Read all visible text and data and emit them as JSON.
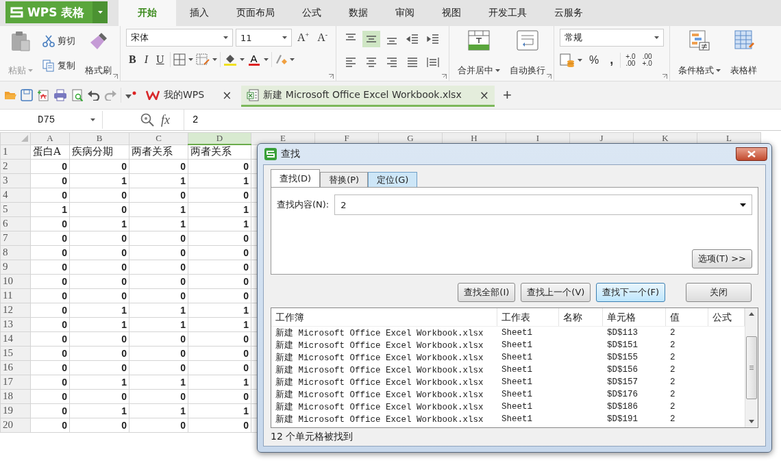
{
  "app_button": {
    "label": "WPS 表格"
  },
  "ribbon_tabs": [
    {
      "label": "开始",
      "selected": true
    },
    {
      "label": "插入",
      "selected": false
    },
    {
      "label": "页面布局",
      "selected": false
    },
    {
      "label": "公式",
      "selected": false
    },
    {
      "label": "数据",
      "selected": false
    },
    {
      "label": "审阅",
      "selected": false
    },
    {
      "label": "视图",
      "selected": false
    },
    {
      "label": "开发工具",
      "selected": false
    },
    {
      "label": "云服务",
      "selected": false
    }
  ],
  "clipboard": {
    "paste": "粘贴",
    "cut": "剪切",
    "copy": "复制",
    "format_painter": "格式刷"
  },
  "font": {
    "name": "宋体",
    "size": "11",
    "grow": "A$^{+}$",
    "shrink": "A$^{-}$",
    "bold": "B",
    "italic": "I",
    "underline": "U",
    "font_color": "A"
  },
  "alignment": [
    {
      "kind": "top",
      "selected": false
    },
    {
      "kind": "middle",
      "selected": true
    },
    {
      "kind": "bottom",
      "selected": false
    },
    {
      "kind": "outdent",
      "selected": false
    },
    {
      "kind": "indent",
      "selected": false
    },
    {
      "kind": "left",
      "selected": false
    },
    {
      "kind": "center",
      "selected": false
    },
    {
      "kind": "right",
      "selected": false
    },
    {
      "kind": "justify",
      "selected": false
    },
    {
      "kind": "distributed",
      "selected": false
    }
  ],
  "merge_center": "合并居中",
  "wrap_text": "自动换行",
  "number": {
    "format": "常规",
    "percent": "%",
    "comma": ",",
    "increase_decimal": [
      "+.0",
      ".00"
    ],
    "decrease_decimal": [
      ".00",
      "+.0"
    ]
  },
  "styles": {
    "conditional_format": "条件格式",
    "table_style": "表格样"
  },
  "doc_tabs": [
    {
      "kind": "home",
      "label": "我的WPS",
      "close": "×",
      "selected": false
    },
    {
      "kind": "workbook",
      "label": "新建 Microsoft Office Excel Workbook.xlsx",
      "close": "×",
      "selected": true
    }
  ],
  "new_tab": "+",
  "formula_bar": {
    "cell": "D75",
    "fx": "fx",
    "value": "2"
  },
  "sheet": {
    "columns": [
      {
        "label": "A",
        "selected": false
      },
      {
        "label": "B",
        "selected": false
      },
      {
        "label": "C",
        "selected": false
      },
      {
        "label": "D",
        "selected": true
      },
      {
        "label": "E",
        "selected": false
      },
      {
        "label": "F",
        "selected": false
      },
      {
        "label": "G",
        "selected": false
      },
      {
        "label": "H",
        "selected": false
      },
      {
        "label": "I",
        "selected": false
      },
      {
        "label": "J",
        "selected": false
      },
      {
        "label": "K",
        "selected": false
      },
      {
        "label": "L",
        "selected": false
      }
    ],
    "rows": [
      {
        "number": "1",
        "cells": [
          "蛋白A",
          "疾病分期",
          "两者关系",
          "两者关系"
        ]
      },
      {
        "number": "2",
        "cells": [
          "0",
          "0",
          "0",
          "0"
        ]
      },
      {
        "number": "3",
        "cells": [
          "0",
          "1",
          "1",
          "1"
        ]
      },
      {
        "number": "4",
        "cells": [
          "0",
          "0",
          "0",
          "0"
        ]
      },
      {
        "number": "5",
        "cells": [
          "1",
          "0",
          "1",
          "1"
        ]
      },
      {
        "number": "6",
        "cells": [
          "0",
          "1",
          "1",
          "1"
        ]
      },
      {
        "number": "7",
        "cells": [
          "0",
          "0",
          "0",
          "0"
        ]
      },
      {
        "number": "8",
        "cells": [
          "0",
          "0",
          "0",
          "0"
        ]
      },
      {
        "number": "9",
        "cells": [
          "0",
          "0",
          "0",
          "0"
        ]
      },
      {
        "number": "10",
        "cells": [
          "0",
          "0",
          "0",
          "0"
        ]
      },
      {
        "number": "11",
        "cells": [
          "0",
          "0",
          "0",
          "0"
        ]
      },
      {
        "number": "12",
        "cells": [
          "0",
          "1",
          "1",
          "1"
        ]
      },
      {
        "number": "13",
        "cells": [
          "0",
          "1",
          "1",
          "1"
        ]
      },
      {
        "number": "14",
        "cells": [
          "0",
          "0",
          "0",
          "0"
        ]
      },
      {
        "number": "15",
        "cells": [
          "0",
          "0",
          "0",
          "0"
        ]
      },
      {
        "number": "16",
        "cells": [
          "0",
          "0",
          "0",
          "0"
        ]
      },
      {
        "number": "17",
        "cells": [
          "0",
          "1",
          "1",
          "1"
        ]
      },
      {
        "number": "18",
        "cells": [
          "0",
          "0",
          "0",
          "0"
        ]
      },
      {
        "number": "19",
        "cells": [
          "0",
          "1",
          "1",
          "1"
        ]
      },
      {
        "number": "20",
        "cells": [
          "0",
          "0",
          "0",
          "0"
        ]
      }
    ]
  },
  "dialog": {
    "title": "查找",
    "tabs": [
      {
        "label": "查找(D)",
        "selected": true,
        "hover": false
      },
      {
        "label": "替换(P)",
        "selected": false,
        "hover": false
      },
      {
        "label": "定位(G)",
        "selected": false,
        "hover": true
      }
    ],
    "find_label": "查找内容(N):",
    "find_value": "2",
    "options_button": "选项(T) >>",
    "buttons": [
      {
        "label": "查找全部(I)",
        "default": false
      },
      {
        "label": "查找上一个(V)",
        "default": false
      },
      {
        "label": "查找下一个(F)",
        "default": true
      },
      {
        "label": "关闭",
        "default": false
      }
    ],
    "results": {
      "columns": [
        "工作簿",
        "工作表",
        "名称",
        "单元格",
        "值",
        "公式"
      ],
      "rows": [
        {
          "workbook": "新建 Microsoft Office Excel Workbook.xlsx",
          "sheet": "Sheet1",
          "cell": "$D$113",
          "value": "2"
        },
        {
          "workbook": "新建 Microsoft Office Excel Workbook.xlsx",
          "sheet": "Sheet1",
          "cell": "$D$151",
          "value": "2"
        },
        {
          "workbook": "新建 Microsoft Office Excel Workbook.xlsx",
          "sheet": "Sheet1",
          "cell": "$D$155",
          "value": "2"
        },
        {
          "workbook": "新建 Microsoft Office Excel Workbook.xlsx",
          "sheet": "Sheet1",
          "cell": "$D$156",
          "value": "2"
        },
        {
          "workbook": "新建 Microsoft Office Excel Workbook.xlsx",
          "sheet": "Sheet1",
          "cell": "$D$157",
          "value": "2"
        },
        {
          "workbook": "新建 Microsoft Office Excel Workbook.xlsx",
          "sheet": "Sheet1",
          "cell": "$D$176",
          "value": "2"
        },
        {
          "workbook": "新建 Microsoft Office Excel Workbook.xlsx",
          "sheet": "Sheet1",
          "cell": "$D$186",
          "value": "2"
        },
        {
          "workbook": "新建 Microsoft Office Excel Workbook.xlsx",
          "sheet": "Sheet1",
          "cell": "$D$191",
          "value": "2"
        }
      ]
    },
    "status": "12 个单元格被找到"
  }
}
